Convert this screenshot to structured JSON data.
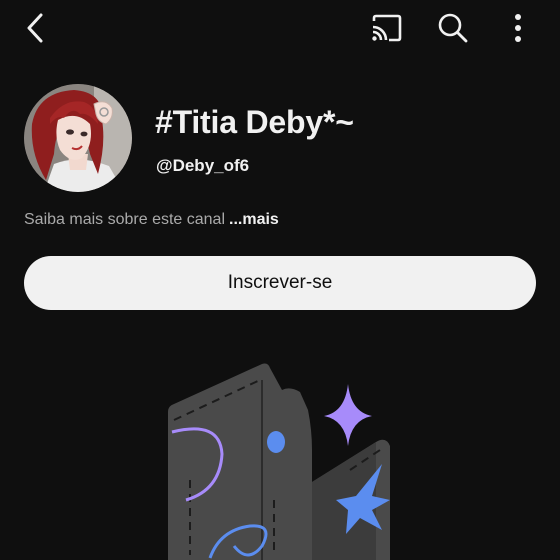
{
  "topbar": {
    "back_icon": "chevron-left-icon",
    "cast_icon": "cast-icon",
    "search_icon": "search-icon",
    "more_icon": "more-vert-icon"
  },
  "channel": {
    "name": "#Titia Deby*~",
    "handle": "@Deby_of6",
    "about_text": "Saiba mais sobre este canal",
    "about_more": "...mais"
  },
  "actions": {
    "subscribe_label": "Inscrever-se"
  },
  "colors": {
    "background": "#0f0f0f",
    "text_primary": "#f1f1f1",
    "text_secondary": "#aaaaaa",
    "button_bg": "#f1f1f1",
    "illustration_purple": "#a78bfa",
    "illustration_blue": "#5b8def"
  }
}
